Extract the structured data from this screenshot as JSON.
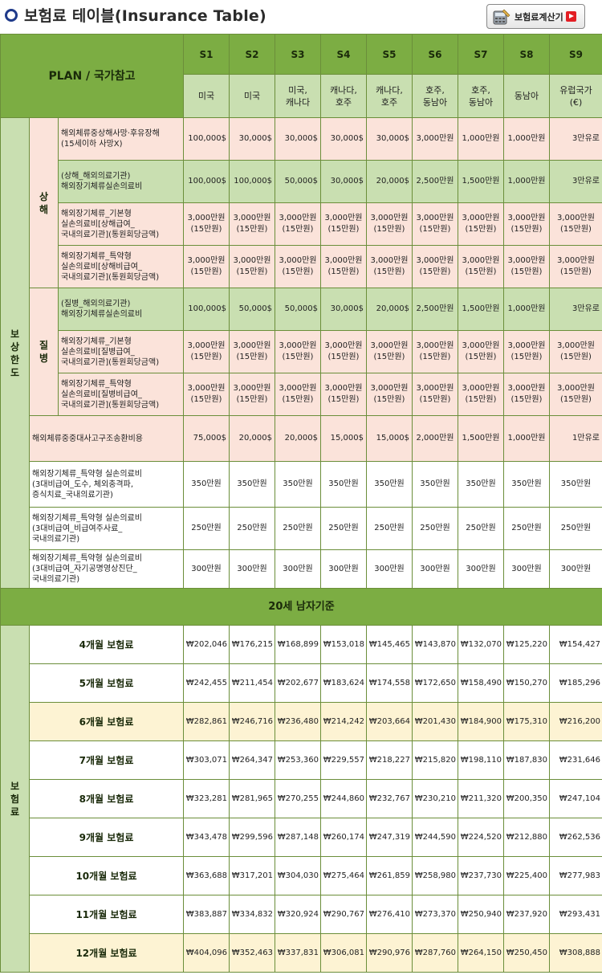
{
  "page": {
    "title": "보험료 테이블(Insurance Table)",
    "calc_button_label": "보험료계산기"
  },
  "colors": {
    "header_green": "#7cad43",
    "light_green": "#c9dfb1",
    "pink": "#fbe3da",
    "cream": "#fdf3d3",
    "title_circle": "#1f3a8a",
    "play_red": "#e31e24"
  },
  "table": {
    "plan_header": "PLAN / 국가참고",
    "plans": [
      "S1",
      "S2",
      "S3",
      "S4",
      "S5",
      "S6",
      "S7",
      "S8",
      "S9"
    ],
    "countries": [
      "미국",
      "미국",
      "미국,\n캐나다",
      "캐나다,\n호주",
      "캐나다,\n호주",
      "호주,\n동남아",
      "호주,\n동남아",
      "동남아",
      "유럽국가\n(€)"
    ],
    "coverage_group_label": "보\n상\n한\n도",
    "injury_label": "상\n해",
    "disease_label": "질\n병",
    "coverage_rows": [
      {
        "label": "해외체류중상해사망·후유장해\n(15세이하 사망X)",
        "values": [
          "100,000$",
          "30,000$",
          "30,000$",
          "30,000$",
          "30,000$",
          "3,000만원",
          "1,000만원",
          "1,000만원",
          "3만유로"
        ]
      },
      {
        "label": "(상해_해외의료기관)\n해외장기체류실손의료비",
        "values": [
          "100,000$",
          "100,000$",
          "50,000$",
          "30,000$",
          "20,000$",
          "2,500만원",
          "1,500만원",
          "1,000만원",
          "3만유로"
        ]
      },
      {
        "label": "해외장기체류_기본형\n실손의료비[상해급여_\n국내의료기관](통원회당금액)",
        "values": [
          "3,000만원\n(15만원)",
          "3,000만원\n(15만원)",
          "3,000만원\n(15만원)",
          "3,000만원\n(15만원)",
          "3,000만원\n(15만원)",
          "3,000만원\n(15만원)",
          "3,000만원\n(15만원)",
          "3,000만원\n(15만원)",
          "3,000만원\n(15만원)"
        ]
      },
      {
        "label": "해외장기체류_특약형\n실손의료비[상해비급여_\n국내의료기관](통원회당금액)",
        "values": [
          "3,000만원\n(15만원)",
          "3,000만원\n(15만원)",
          "3,000만원\n(15만원)",
          "3,000만원\n(15만원)",
          "3,000만원\n(15만원)",
          "3,000만원\n(15만원)",
          "3,000만원\n(15만원)",
          "3,000만원\n(15만원)",
          "3,000만원\n(15만원)"
        ]
      },
      {
        "label": "(질병_해외의료기관)\n해외장기체류실손의료비",
        "values": [
          "100,000$",
          "50,000$",
          "50,000$",
          "30,000$",
          "20,000$",
          "2,500만원",
          "1,500만원",
          "1,000만원",
          "3만유로"
        ]
      },
      {
        "label": "해외장기체류_기본형\n실손의료비[질병급여_\n국내의료기관](통원회당금액)",
        "values": [
          "3,000만원\n(15만원)",
          "3,000만원\n(15만원)",
          "3,000만원\n(15만원)",
          "3,000만원\n(15만원)",
          "3,000만원\n(15만원)",
          "3,000만원\n(15만원)",
          "3,000만원\n(15만원)",
          "3,000만원\n(15만원)",
          "3,000만원\n(15만원)"
        ]
      },
      {
        "label": "해외장기체류_특약형\n실손의료비[질병비급여_\n국내의료기관](통원회당금액)",
        "values": [
          "3,000만원\n(15만원)",
          "3,000만원\n(15만원)",
          "3,000만원\n(15만원)",
          "3,000만원\n(15만원)",
          "3,000만원\n(15만원)",
          "3,000만원\n(15만원)",
          "3,000만원\n(15만원)",
          "3,000만원\n(15만원)",
          "3,000만원\n(15만원)"
        ]
      },
      {
        "label": "해외체류중중대사고구조송환비용",
        "values": [
          "75,000$",
          "20,000$",
          "20,000$",
          "15,000$",
          "15,000$",
          "2,000만원",
          "1,500만원",
          "1,000만원",
          "1만유로"
        ]
      },
      {
        "label": "해외장기체류_특약형 실손의료비\n(3대비급여_도수, 체외충격파,\n증식치료_국내의료기관)",
        "values": [
          "350만원",
          "350만원",
          "350만원",
          "350만원",
          "350만원",
          "350만원",
          "350만원",
          "350만원",
          "350만원"
        ]
      },
      {
        "label": "해외장기체류_특약형 실손의료비\n(3대비급여_비급여주사료_\n국내의료기관)",
        "values": [
          "250만원",
          "250만원",
          "250만원",
          "250만원",
          "250만원",
          "250만원",
          "250만원",
          "250만원",
          "250만원"
        ]
      },
      {
        "label": "해외장기체류_특약형 실손의료비\n(3대비급여_자기공명영상진단_\n국내의료기관)",
        "values": [
          "300만원",
          "300만원",
          "300만원",
          "300만원",
          "300만원",
          "300만원",
          "300만원",
          "300만원",
          "300만원"
        ]
      }
    ],
    "premium_section_label": "20세 남자기준",
    "premium_group_label": "보\n험\n료",
    "premium_rows": [
      {
        "label": "4개월 보험료",
        "values": [
          "₩202,046",
          "₩176,215",
          "₩168,899",
          "₩153,018",
          "₩145,465",
          "₩143,870",
          "₩132,070",
          "₩125,220",
          "₩154,427"
        ]
      },
      {
        "label": "5개월 보험료",
        "values": [
          "₩242,455",
          "₩211,454",
          "₩202,677",
          "₩183,624",
          "₩174,558",
          "₩172,650",
          "₩158,490",
          "₩150,270",
          "₩185,296"
        ]
      },
      {
        "label": "6개월 보험료",
        "values": [
          "₩282,861",
          "₩246,716",
          "₩236,480",
          "₩214,242",
          "₩203,664",
          "₩201,430",
          "₩184,900",
          "₩175,310",
          "₩216,200"
        ]
      },
      {
        "label": "7개월 보험료",
        "values": [
          "₩303,071",
          "₩264,347",
          "₩253,360",
          "₩229,557",
          "₩218,227",
          "₩215,820",
          "₩198,110",
          "₩187,830",
          "₩231,646"
        ]
      },
      {
        "label": "8개월 보험료",
        "values": [
          "₩323,281",
          "₩281,965",
          "₩270,255",
          "₩244,860",
          "₩232,767",
          "₩230,210",
          "₩211,320",
          "₩200,350",
          "₩247,104"
        ]
      },
      {
        "label": "9개월 보험료",
        "values": [
          "₩343,478",
          "₩299,596",
          "₩287,148",
          "₩260,174",
          "₩247,319",
          "₩244,590",
          "₩224,520",
          "₩212,880",
          "₩262,536"
        ]
      },
      {
        "label": "10개월 보험료",
        "values": [
          "₩363,688",
          "₩317,201",
          "₩304,030",
          "₩275,464",
          "₩261,859",
          "₩258,980",
          "₩237,730",
          "₩225,400",
          "₩277,983"
        ]
      },
      {
        "label": "11개월 보험료",
        "values": [
          "₩383,887",
          "₩334,832",
          "₩320,924",
          "₩290,767",
          "₩276,410",
          "₩273,370",
          "₩250,940",
          "₩237,920",
          "₩293,431"
        ]
      },
      {
        "label": "12개월 보험료",
        "values": [
          "₩404,096",
          "₩352,463",
          "₩337,831",
          "₩306,081",
          "₩290,976",
          "₩287,760",
          "₩264,150",
          "₩250,450",
          "₩308,888"
        ]
      }
    ]
  }
}
